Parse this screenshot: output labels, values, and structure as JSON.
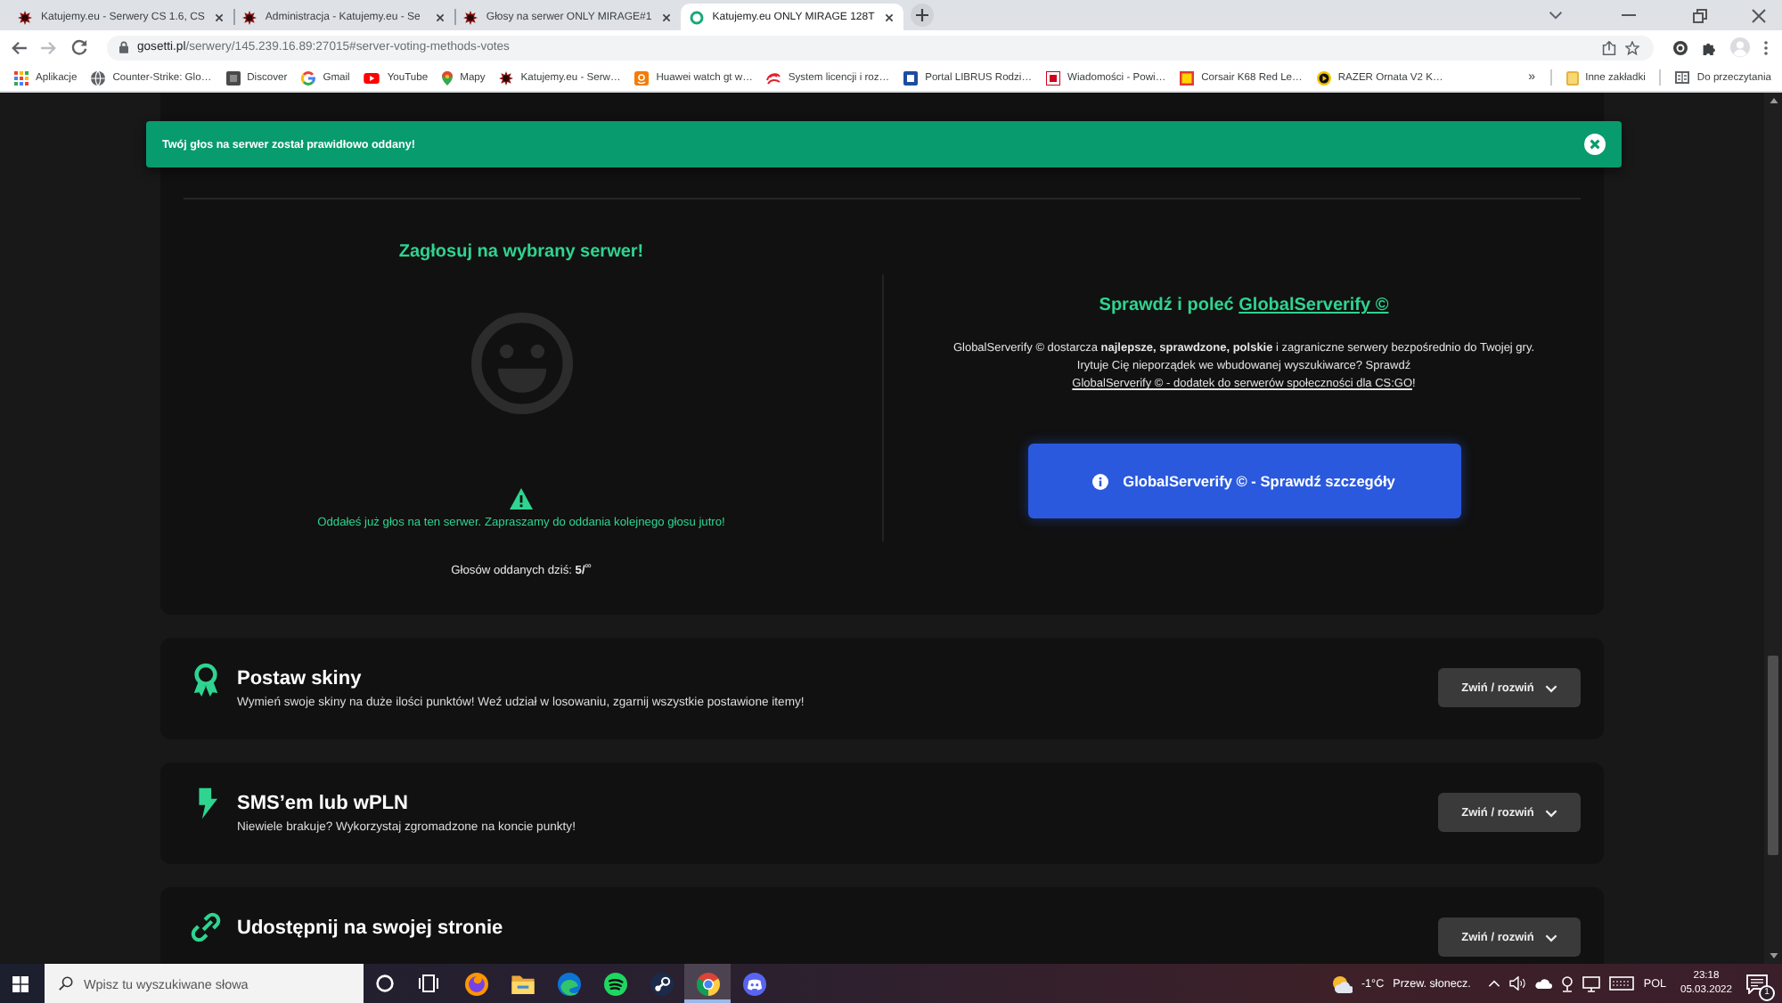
{
  "browser": {
    "tabs": [
      {
        "title": "Katujemy.eu - Serwery CS 1.6, CS",
        "selected": false
      },
      {
        "title": "Administracja - Katujemy.eu - Se",
        "selected": false
      },
      {
        "title": "Głosy na serwer ONLY MIRAGE#1",
        "selected": false
      },
      {
        "title": "Katujemy.eu ONLY MIRAGE 128T",
        "selected": true
      }
    ],
    "address_bar": {
      "host": "gosetti.pl",
      "path": "/serwery/145.239.16.89:27015#server-voting-methods-votes"
    },
    "bookmarks": [
      {
        "label": "Aplikacje"
      },
      {
        "label": "Counter-Strike: Glo…"
      },
      {
        "label": "Discover"
      },
      {
        "label": "Gmail"
      },
      {
        "label": "YouTube"
      },
      {
        "label": "Mapy"
      },
      {
        "label": "Katujemy.eu - Serw…"
      },
      {
        "label": "Huawei watch gt w…"
      },
      {
        "label": "System licencji i roz…"
      },
      {
        "label": "Portal LIBRUS Rodzi…"
      },
      {
        "label": "Wiadomości - Powi…"
      },
      {
        "label": "Corsair K68 Red Le…"
      },
      {
        "label": "RAZER Ornata V2 K…"
      }
    ],
    "bookmarks_overflow": "»",
    "other_bookmarks": "Inne zakładki",
    "reading_list": "Do przeczytania"
  },
  "page": {
    "notification": {
      "message": "Twój głos na serwer został prawidłowo oddany!"
    },
    "vote_panel": {
      "title": "Zagłosuj na wybrany serwer!",
      "warning": "Oddałeś już głos na ten serwer. Zapraszamy do oddania kolejnego głosu jutro!",
      "votes_today": "Głosów oddanych dziś: **5/**$^{∞}$"
    },
    "promo": {
      "title": "Sprawdź i poleć",
      "title_link": "GlobalServerify ©",
      "text": "GlobalServerify © dostarcza **najlepsze, sprawdzone, polskie** i zagraniczne serwery bezpośrednio do Twojej gry. Irytuje Cię nieporządek we wbudowanej wyszukiwarce? Sprawdź",
      "text_link": "GlobalServerify © - dodatek do serwerów społeczności dla CS:GO",
      "text_end": "!",
      "button": "GlobalServerify © - Sprawdź szczegóły"
    },
    "sections": [
      {
        "title": "Postaw skiny",
        "description": "Wymień swoje skiny na duże ilości punktów! Weź udział w losowaniu, zgarnij wszystkie postawione itemy!",
        "toggle": "Zwiń / rozwiń"
      },
      {
        "title": "SMS’em lub wPLN",
        "description": "Niewiele brakuje? Wykorzystaj zgromadzone na koncie punkty!",
        "toggle": "Zwiń / rozwiń"
      },
      {
        "title": "Udostępnij na swojej stronie",
        "toggle": "Zwiń / rozwiń"
      }
    ]
  },
  "taskbar": {
    "search_placeholder": "Wpisz tu wyszukiwane słowa",
    "apps": [
      {
        "selected": false
      },
      {
        "selected": false
      },
      {
        "selected": false
      },
      {
        "selected": false
      },
      {
        "selected": false
      },
      {
        "selected": true
      },
      {
        "selected": false
      }
    ],
    "weather_temp": "-1°C",
    "weather_text": "Przew. słonecz.",
    "language": "POL",
    "time": "23:18",
    "date": "05.03.2022",
    "notification_count": "1"
  }
}
